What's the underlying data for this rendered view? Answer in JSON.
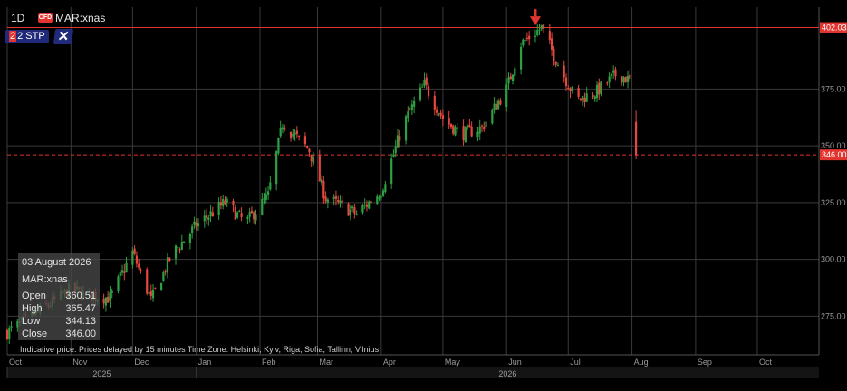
{
  "header": {
    "timeframe": "1D",
    "badge": "CFD",
    "symbol": "MAR:xnas",
    "order_label_lead": "2",
    "order_label_rest": "2 STP",
    "close_glyph": "✕"
  },
  "tooltip": {
    "date": "03 August 2026",
    "symbol": "MAR:xnas",
    "rows": [
      {
        "label": "Open",
        "value": "360.51"
      },
      {
        "label": "High",
        "value": "365.47"
      },
      {
        "label": "Low",
        "value": "344.13"
      },
      {
        "label": "Close",
        "value": "346.00"
      }
    ]
  },
  "footnote": "Indicative price. Prices delayed by 15 minutes    Time Zone: Helsinki, Kyiv, Riga, Sofia, Tallinn, Vilnius",
  "chart_data": {
    "type": "candlestick",
    "instrument": "MAR:xnas",
    "interval": "1D",
    "ylim": [
      258,
      411
    ],
    "y_ticks": [
      275,
      300,
      325,
      350,
      375
    ],
    "x_month_labels": [
      "Oct",
      "Nov",
      "Dec",
      "Jan",
      "Feb",
      "Mar",
      "Apr",
      "May",
      "Jun",
      "Jul",
      "Aug",
      "Sep",
      "Oct"
    ],
    "x_year_labels": [
      "2025",
      "2026"
    ],
    "horizontal_lines": [
      {
        "name": "stop-level",
        "value": 402.03,
        "label": "402.03",
        "style": "solid"
      },
      {
        "name": "last-price",
        "value": 346.0,
        "label": "346.00",
        "style": "dashed"
      }
    ],
    "last_candle": {
      "date": "03 August 2026",
      "open": 360.51,
      "high": 365.47,
      "low": 344.13,
      "close": 346.0
    },
    "marker": {
      "type": "arrow-down",
      "at_date": "mid-June 2026",
      "value": 403
    },
    "approx_close_path": [
      {
        "date": "2025-10-01",
        "close": 268
      },
      {
        "date": "2025-10-15",
        "close": 276
      },
      {
        "date": "2025-11-01",
        "close": 287
      },
      {
        "date": "2025-11-10",
        "close": 284
      },
      {
        "date": "2025-11-20",
        "close": 283
      },
      {
        "date": "2025-12-01",
        "close": 303
      },
      {
        "date": "2025-12-10",
        "close": 282
      },
      {
        "date": "2025-12-20",
        "close": 302
      },
      {
        "date": "2026-01-01",
        "close": 315
      },
      {
        "date": "2026-01-15",
        "close": 325
      },
      {
        "date": "2026-01-25",
        "close": 316
      },
      {
        "date": "2026-02-05",
        "close": 328
      },
      {
        "date": "2026-02-12",
        "close": 360
      },
      {
        "date": "2026-02-25",
        "close": 348
      },
      {
        "date": "2026-03-05",
        "close": 327
      },
      {
        "date": "2026-03-20",
        "close": 320
      },
      {
        "date": "2026-04-01",
        "close": 330
      },
      {
        "date": "2026-04-12",
        "close": 360
      },
      {
        "date": "2026-04-22",
        "close": 377
      },
      {
        "date": "2026-05-01",
        "close": 362
      },
      {
        "date": "2026-05-10",
        "close": 355
      },
      {
        "date": "2026-05-20",
        "close": 358
      },
      {
        "date": "2026-06-01",
        "close": 375
      },
      {
        "date": "2026-06-08",
        "close": 395
      },
      {
        "date": "2026-06-18",
        "close": 402
      },
      {
        "date": "2026-06-25",
        "close": 388
      },
      {
        "date": "2026-07-05",
        "close": 370
      },
      {
        "date": "2026-07-15",
        "close": 374
      },
      {
        "date": "2026-07-25",
        "close": 382
      },
      {
        "date": "2026-08-01",
        "close": 378
      },
      {
        "date": "2026-08-03",
        "close": 346
      }
    ]
  },
  "colors": {
    "up": "#2ea043",
    "down": "#e5483f",
    "grid": "#3a3a3a",
    "price_line": "#e2352f",
    "background": "#000000",
    "axis_text": "#9a9a9a"
  }
}
